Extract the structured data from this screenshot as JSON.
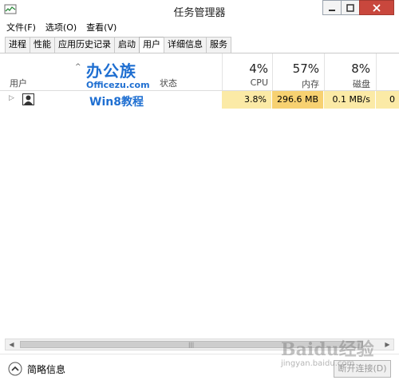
{
  "window": {
    "title": "任务管理器"
  },
  "menu": [
    "文件(F)",
    "选项(O)",
    "查看(V)"
  ],
  "tabs": [
    {
      "label": "进程",
      "active": false
    },
    {
      "label": "性能",
      "active": false
    },
    {
      "label": "应用历史记录",
      "active": false
    },
    {
      "label": "启动",
      "active": false
    },
    {
      "label": "用户",
      "active": true
    },
    {
      "label": "详细信息",
      "active": false
    },
    {
      "label": "服务",
      "active": false
    }
  ],
  "columns": {
    "user": "用户",
    "status": "状态",
    "cpu": {
      "percent": "4%",
      "label": "CPU"
    },
    "memory": {
      "percent": "57%",
      "label": "内存"
    },
    "disk": {
      "percent": "8%",
      "label": "磁盘"
    }
  },
  "rows": [
    {
      "cpu": "3.8%",
      "memory": "296.6 MB",
      "disk": "0.1 MB/s",
      "network": "0"
    }
  ],
  "footer": {
    "fewer_details": "简略信息",
    "end_button": "断开连接(D)"
  },
  "watermarks": {
    "logo_main": "办公族",
    "logo_site": "Officezu.com",
    "logo_sub": "Win8教程",
    "baidu": "Baidu经验",
    "baidu_url": "jingyan.baidu.com"
  },
  "colors": {
    "cpu_cell": "#fbeaa6",
    "memory_cell": "#f7d171",
    "close_button": "#c9473d"
  }
}
